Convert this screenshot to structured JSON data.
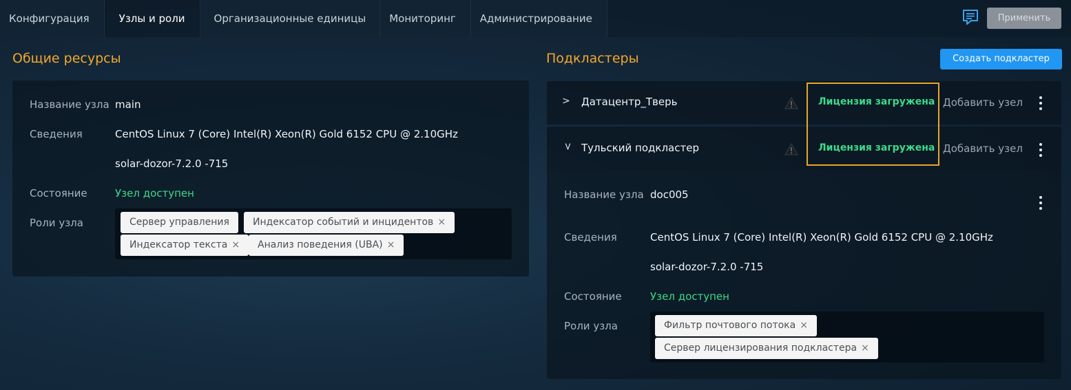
{
  "nav": {
    "tabs": [
      "Конфигурация",
      "Узлы и роли",
      "Организационные единицы",
      "Мониторинг",
      "Администрирование"
    ],
    "active_tab": "Узлы и роли",
    "apply_label": "Применить",
    "chat_icon": "chat-icon"
  },
  "shared": {
    "title": "Общие ресурсы",
    "node_name_label": "Название узла",
    "node_name": "main",
    "info_label": "Сведения",
    "os": "CentOS Linux 7 (Core)",
    "cpu": "Intel(R) Xeon(R) Gold 6152 CPU @ 2.10GHz",
    "version": "solar-dozor-7.2.0 -715",
    "state_label": "Состояние",
    "state": "Узел доступен",
    "roles_label": "Роли узла",
    "roles": [
      {
        "label": "Сервер управления",
        "removable": false
      },
      {
        "label": "Индексатор событий и инцидентов",
        "removable": true
      },
      {
        "label": "Индексатор текста",
        "removable": true
      },
      {
        "label": "Анализ поведения (UBA)",
        "removable": true
      }
    ]
  },
  "subclusters": {
    "title": "Подкластеры",
    "create_label": "Создать подкластер",
    "items": [
      {
        "name": "Датацентр_Тверь",
        "expanded": false,
        "license": "Лицензия загружена",
        "add_node": "Добавить узел",
        "icon": "warning-icon"
      },
      {
        "name": "Тульский подкластер",
        "expanded": true,
        "license": "Лицензия загружена",
        "add_node": "Добавить узел",
        "icon": "warning-icon"
      }
    ],
    "expanded_node": {
      "node_name_label": "Название узла",
      "node_name": "doc005",
      "info_label": "Сведения",
      "os": "CentOS Linux 7 (Core)",
      "cpu": "Intel(R) Xeon(R) Gold 6152 CPU @ 2.10GHz",
      "version": "solar-dozor-7.2.0 -715",
      "state_label": "Состояние",
      "state": "Узел доступен",
      "roles_label": "Роли узла",
      "roles": [
        {
          "label": "Фильтр почтового потока",
          "removable": true
        },
        {
          "label": "Сервер лицензирования подкластера",
          "removable": true
        }
      ]
    }
  },
  "colors": {
    "accent": "#f5a72a",
    "status_ok": "#3ed98a",
    "primary_button": "#2196f3",
    "disabled_button": "#8a9199",
    "highlight": "#e9a72a"
  }
}
